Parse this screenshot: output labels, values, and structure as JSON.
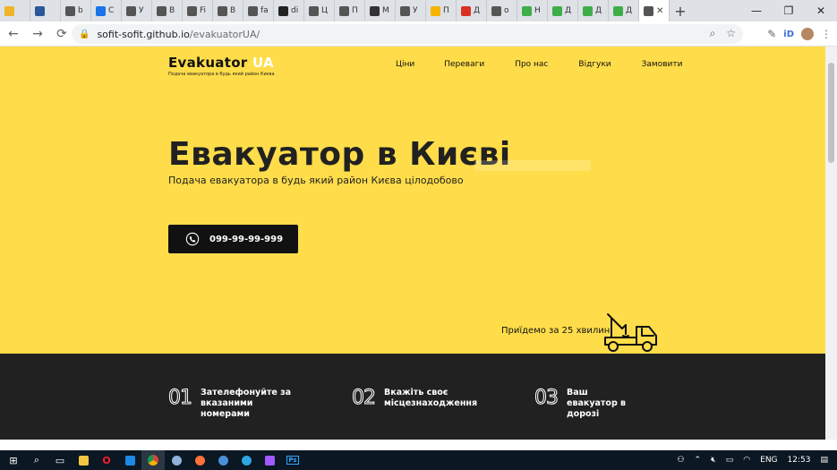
{
  "browser": {
    "tabs": [
      {
        "label": "",
        "icon": "extension-icon",
        "color": "#f0b429"
      },
      {
        "label": "",
        "icon": "word-icon",
        "color": "#2b579a"
      },
      {
        "label": "b",
        "icon": "comment-icon",
        "color": "#555555"
      },
      {
        "label": "С",
        "icon": "docs-icon",
        "color": "#1a73e8"
      },
      {
        "label": "У",
        "icon": "globe-icon",
        "color": "#555555"
      },
      {
        "label": "В",
        "icon": "globe-icon",
        "color": "#555555"
      },
      {
        "label": "Fi",
        "icon": "globe-icon",
        "color": "#555555"
      },
      {
        "label": "В",
        "icon": "globe-icon",
        "color": "#555555"
      },
      {
        "label": "fa",
        "icon": "globe-icon",
        "color": "#555555"
      },
      {
        "label": "di",
        "icon": "github-icon",
        "color": "#222222"
      },
      {
        "label": "Ц",
        "icon": "globe-icon",
        "color": "#555555"
      },
      {
        "label": "П",
        "icon": "globe-icon",
        "color": "#555555"
      },
      {
        "label": "М",
        "icon": "app-icon",
        "color": "#333333"
      },
      {
        "label": "У",
        "icon": "handshake-icon",
        "color": "#555555"
      },
      {
        "label": "П",
        "icon": "folder-icon",
        "color": "#f4b400"
      },
      {
        "label": "Д",
        "icon": "gmail-icon",
        "color": "#d93025"
      },
      {
        "label": "o",
        "icon": "globe-icon",
        "color": "#555555"
      },
      {
        "label": "Н",
        "icon": "do-icon",
        "color": "#3fae49"
      },
      {
        "label": "Д",
        "icon": "do-icon",
        "color": "#3fae49"
      },
      {
        "label": "Д",
        "icon": "do-icon",
        "color": "#3fae49"
      },
      {
        "label": "Д",
        "icon": "do-icon",
        "color": "#3fae49"
      }
    ],
    "active_tab_close": "✕",
    "new_tab": "+",
    "window_controls": {
      "minimize": "—",
      "maximize": "❐",
      "close": "✕"
    },
    "nav": {
      "back": "←",
      "forward": "→",
      "reload": "⟳"
    },
    "url_host": "sofit-sofit.github.io",
    "url_path": "/evakuatorUA/"
  },
  "site": {
    "logo_main": "Evakuator",
    "logo_accent": " UA",
    "logo_tagline": "Подача евакуатора в будь який район Києва",
    "nav": [
      "Ціни",
      "Переваги",
      "Про нас",
      "Відгуки",
      "Замовити"
    ],
    "hero_title": "Евакуатор в Києві",
    "hero_subtitle": "Подача евакуатора в будь який район Києва цілодобово",
    "phone": "099-99-99-999",
    "arrival": "Приїдемо за 25 хвилин",
    "steps": [
      {
        "num": "01",
        "text": "Зателефонуйте за вказаними номерами"
      },
      {
        "num": "02",
        "text": "Вкажіть своє місцезнаходження"
      },
      {
        "num": "03",
        "text": "Ваш евакуатор в дорозі"
      }
    ],
    "colors": {
      "brand_yellow": "#ffdd4a",
      "dark": "#212121"
    }
  },
  "taskbar": {
    "lang": "ENG",
    "time": "12:53"
  }
}
